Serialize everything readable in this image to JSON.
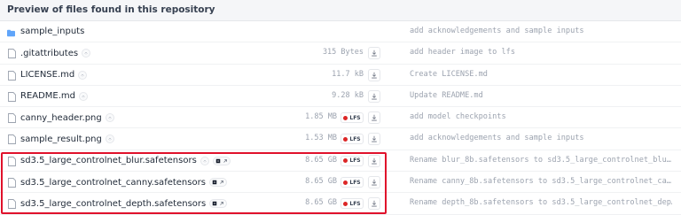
{
  "header": {
    "title": "Preview of files found in this repository"
  },
  "files": [
    {
      "name": "sample_inputs",
      "type": "folder",
      "size": "",
      "lfs": false,
      "commit": "add acknowledgements and sample inputs"
    },
    {
      "name": ".gitattributes",
      "type": "file",
      "size": "315 Bytes",
      "lfs": false,
      "commit": "add header image to lfs"
    },
    {
      "name": "LICENSE.md",
      "type": "file",
      "size": "11.7 kB",
      "lfs": false,
      "commit": "Create LICENSE.md"
    },
    {
      "name": "README.md",
      "type": "file",
      "size": "9.28 kB",
      "lfs": false,
      "commit": "Update README.md"
    },
    {
      "name": "canny_header.png",
      "type": "file",
      "size": "1.85 MB",
      "lfs": true,
      "lfs_label": "LFS",
      "commit": "add model checkpoints"
    },
    {
      "name": "sample_result.png",
      "type": "file",
      "size": "1.53 MB",
      "lfs": true,
      "lfs_label": "LFS",
      "commit": "add acknowledgements and sample inputs"
    },
    {
      "name": "sd3.5_large_controlnet_blur.safetensors",
      "type": "file",
      "size": "8.65 GB",
      "lfs": true,
      "lfs_label": "LFS",
      "commit": "Rename blur_8b.safetensors to sd3.5_large_controlnet_blu…"
    },
    {
      "name": "sd3.5_large_controlnet_canny.safetensors",
      "type": "file",
      "size": "8.65 GB",
      "lfs": true,
      "lfs_label": "LFS",
      "commit": "Rename canny_8b.safetensors to sd3.5_large_controlnet_ca…"
    },
    {
      "name": "sd3.5_large_controlnet_depth.safetensors",
      "type": "file",
      "size": "8.65 GB",
      "lfs": true,
      "lfs_label": "LFS",
      "commit": "Rename depth_8b.safetensors to sd3.5_large_controlnet_dep…"
    }
  ],
  "colors": {
    "highlight_border": "#e0112b",
    "lfs_dot": "#dc2626",
    "folder_icon": "#60a5fa"
  }
}
